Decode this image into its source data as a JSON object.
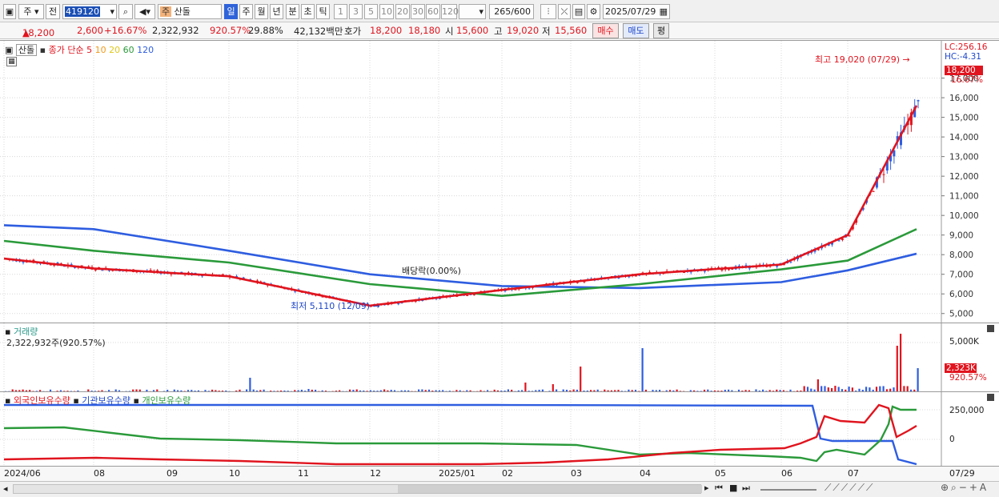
{
  "toolbar": {
    "market": "주",
    "prev": "전",
    "code": "419120",
    "stock_tag": "주",
    "stock_name": "산돌",
    "periods": [
      "일",
      "주",
      "월",
      "년",
      "분",
      "초",
      "틱"
    ],
    "numbers": [
      "1",
      "3",
      "5",
      "10",
      "20",
      "30",
      "60",
      "120"
    ],
    "count": "265",
    "count_max": "/600",
    "date": "2025/07/29"
  },
  "quote": {
    "price": "18,200",
    "arrow": "▲",
    "change": "2,600",
    "change_pct": "+16.67%",
    "volume": "2,322,932",
    "volume_ratio": "920.57%",
    "turnover": "29.88%",
    "amount": "42,132백만",
    "ask_label": "호가",
    "ask": "18,200",
    "bid": "18,180",
    "open_label": "시",
    "open": "15,600",
    "high_label": "고",
    "high": "19,020",
    "low_label": "저",
    "low": "15,560",
    "buy_label": "매수",
    "sell_label": "매도",
    "eval_label": "평"
  },
  "price_panel": {
    "legend_name": "산돌",
    "legend_ma_title": "종가 단순",
    "ma_periods": [
      "5",
      "10",
      "20",
      "60",
      "120"
    ],
    "ma_colors": [
      "#e0141e",
      "#f09a1e",
      "#f5e01e",
      "#2a9a3a",
      "#2e5de0"
    ],
    "lc": "LC:256.16",
    "hc": "HC:-4.31",
    "last_price_tag": "18,200",
    "last_pct_tag": "16.67%",
    "y_ticks": [
      "17,000",
      "16,000",
      "15,000",
      "14,000",
      "13,000",
      "12,000",
      "11,000",
      "10,000",
      "9,000",
      "8,000",
      "7,000",
      "6,000",
      "5,000"
    ],
    "high_note": "최고 19,020 (07/29)",
    "low_note": "최저 5,110 (12/09)",
    "dividend_note": "배당락(0.00%)"
  },
  "volume_panel": {
    "title": "거래량",
    "value": "2,322,932주(920.57%)",
    "y_ticks": [
      "5,000K"
    ],
    "last_tag": "2,323K",
    "last_pct": "920.57%"
  },
  "holding_panel": {
    "legend": [
      "외국인보유수량",
      "기관보유수량",
      "개인보유수량"
    ],
    "legend_colors": [
      "#e0141e",
      "#2e5de0",
      "#2a9a3a"
    ],
    "y_ticks": [
      "250,000",
      "0"
    ]
  },
  "x_labels": [
    "2024/06",
    "08",
    "09",
    "10",
    "11",
    "12",
    "2025/01",
    "02",
    "03",
    "04",
    "05",
    "06",
    "07",
    "07/29"
  ],
  "chart_data": {
    "type": "line",
    "title": "",
    "xlabel": "",
    "ylabel": "",
    "ylim": [
      4500,
      18900
    ],
    "series": [
      {
        "name": "120",
        "x": [
          "2024/06",
          "2024/08",
          "2024/10",
          "2024/12",
          "2025/02",
          "2025/04",
          "2025/06",
          "2025/07",
          "2025/07/29"
        ],
        "values": [
          9500,
          9300,
          8200,
          7000,
          6400,
          6300,
          6600,
          7200,
          8050
        ]
      },
      {
        "name": "60",
        "x": [
          "2024/06",
          "2024/08",
          "2024/10",
          "2024/12",
          "2025/02",
          "2025/04",
          "2025/06",
          "2025/07",
          "2025/07/29"
        ],
        "values": [
          8700,
          8200,
          7600,
          6500,
          5900,
          6500,
          7250,
          7700,
          9300
        ]
      },
      {
        "name": "5",
        "x": [
          "2024/06",
          "2024/08",
          "2024/10",
          "2024/12",
          "2025/02",
          "2025/04",
          "2025/06",
          "2025/07",
          "2025/07/29"
        ],
        "values": [
          7800,
          7300,
          6900,
          5400,
          6200,
          7000,
          7500,
          9000,
          15600
        ]
      }
    ]
  }
}
